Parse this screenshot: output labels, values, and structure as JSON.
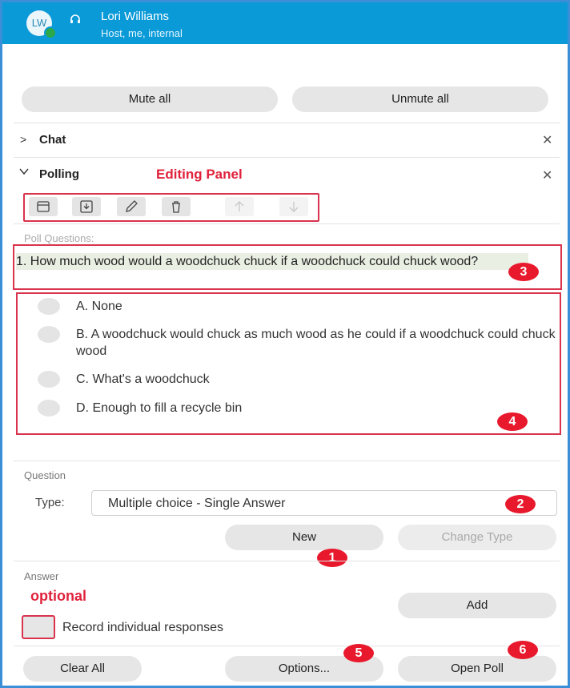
{
  "header": {
    "avatar_initials": "LW",
    "user_name": "Lori Williams",
    "user_role": "Host, me, internal",
    "bg_color": "#0a9ad8"
  },
  "controls": {
    "mute_all": "Mute all",
    "unmute_all": "Unmute all"
  },
  "chat": {
    "title": "Chat",
    "collapsed": true
  },
  "polling": {
    "title": "Polling",
    "annotation": "Editing Panel",
    "toolbar_icons": [
      "folder-icon",
      "download-icon",
      "pencil-icon",
      "trash-icon",
      "arrow-up-icon",
      "arrow-down-icon"
    ]
  },
  "poll_questions": {
    "label": "Poll Questions:",
    "question": "1.  How much wood would a woodchuck chuck if a woodchuck could chuck wood?",
    "answers": [
      "A.  None",
      "B.  A woodchuck would chuck as much wood as he could if a woodchuck could chuck wood",
      "C.  What's a woodchuck",
      "D.  Enough to fill a recycle bin"
    ]
  },
  "question_section": {
    "label": "Question",
    "type_label": "Type:",
    "type_value": "Multiple choice - Single Answer",
    "new_button": "New",
    "change_type_button": "Change Type"
  },
  "answer_section": {
    "label": "Answer",
    "annotation": "optional",
    "add_button": "Add",
    "record_label": "Record individual responses"
  },
  "footer": {
    "clear_all": "Clear All",
    "options": "Options...",
    "open_poll": "Open Poll"
  },
  "badges": [
    "1",
    "2",
    "3",
    "4",
    "5",
    "6"
  ],
  "accent_color": "#e0223c"
}
